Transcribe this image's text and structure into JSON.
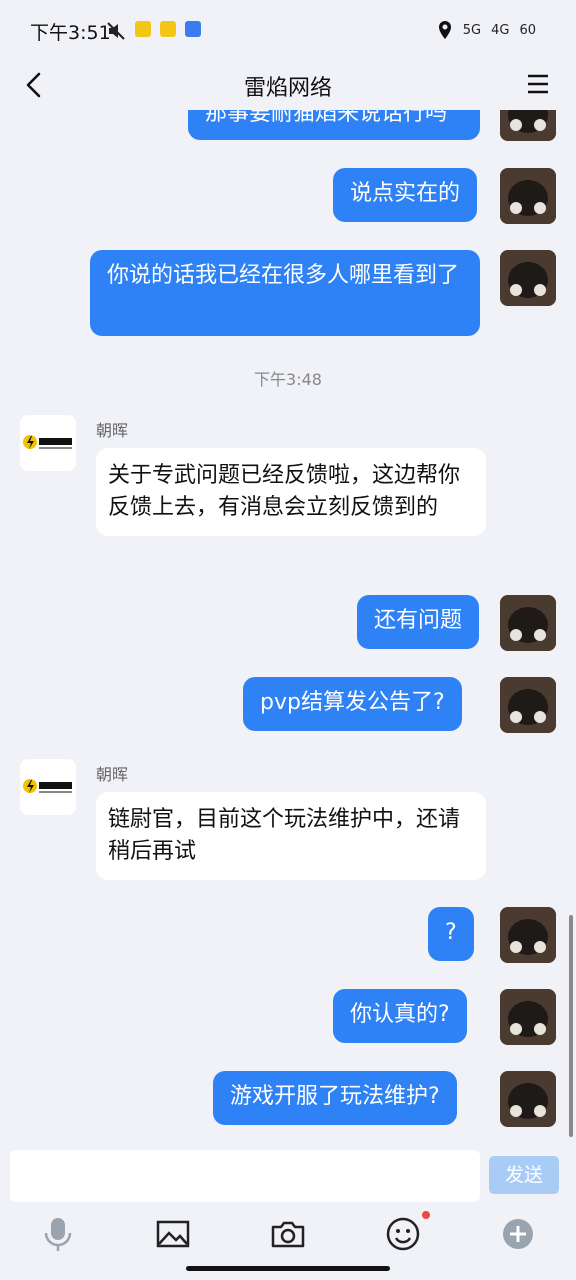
{
  "status_bar": {
    "time": "下午3:51",
    "net1": "5G",
    "net2": "4G",
    "battery": "60"
  },
  "header": {
    "title": "雷焰网络"
  },
  "messages": {
    "m0": "那事要耐猫焰来说话行吗",
    "m1": "说点实在的",
    "m2": "你说的话我已经在很多人哪里看到了",
    "time1": "下午3:48",
    "sender1": "朝晖",
    "m3": "关于专武问题已经反馈啦，这边帮你反馈上去，有消息会立刻反馈到的",
    "m4": "还有问题",
    "m5": "pvp结算发公告了?",
    "sender2": "朝晖",
    "m6": "链尉官，目前这个玩法维护中，还请稍后再试",
    "m7": "?",
    "m8": "你认真的?",
    "m9": "游戏开服了玩法维护?"
  },
  "input": {
    "send_label": "发送"
  },
  "colors": {
    "accent": "#2f82f5",
    "background": "#f1f2f7",
    "send_disabled": "#a9ccf7"
  }
}
